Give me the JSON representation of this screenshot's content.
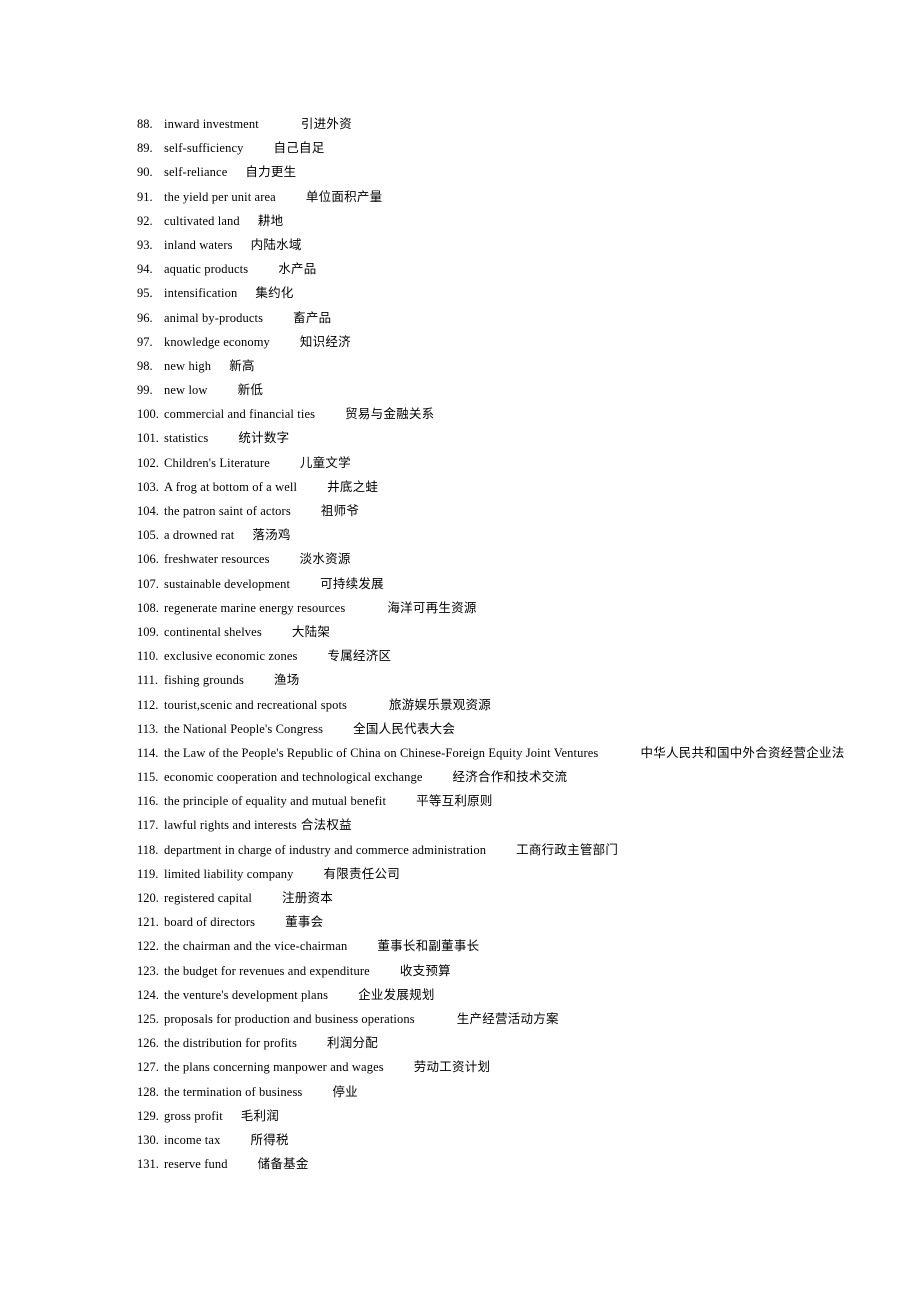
{
  "document": {
    "type": "bilingual-glossary",
    "language_pair": "English-Chinese",
    "first_item_number": 88,
    "last_item_number": 131
  },
  "entries": [
    {
      "num": "88.",
      "en": "inward investment",
      "zh": "引进外资",
      "gap": "gap-l"
    },
    {
      "num": "89.",
      "en": "self-sufficiency",
      "zh": "自己自足",
      "gap": "gap-m"
    },
    {
      "num": "90.",
      "en": "self-reliance",
      "zh": "自力更生",
      "gap": "gap-s"
    },
    {
      "num": "91.",
      "en": "the yield per unit area",
      "zh": "单位面积产量",
      "gap": "gap-m"
    },
    {
      "num": "92.",
      "en": "cultivated land",
      "zh": "耕地",
      "gap": "gap-s"
    },
    {
      "num": "93.",
      "en": "inland waters",
      "zh": "内陆水域",
      "gap": "gap-s"
    },
    {
      "num": "94.",
      "en": "aquatic products",
      "zh": "水产品",
      "gap": "gap-m"
    },
    {
      "num": "95.",
      "en": "intensification",
      "zh": "集约化",
      "gap": "gap-s"
    },
    {
      "num": "96.",
      "en": "animal by-products",
      "zh": "畜产品",
      "gap": "gap-m"
    },
    {
      "num": "97.",
      "en": "knowledge economy",
      "zh": "知识经济",
      "gap": "gap-m"
    },
    {
      "num": "98.",
      "en": "new high",
      "zh": "新高",
      "gap": "gap-s"
    },
    {
      "num": "99.",
      "en": "new low",
      "zh": "新低",
      "gap": "gap-m"
    },
    {
      "num": "100.",
      "en": "commercial and financial ties",
      "zh": "贸易与金融关系",
      "gap": "gap-m"
    },
    {
      "num": "101.",
      "en": "statistics",
      "zh": "统计数字",
      "gap": "gap-m"
    },
    {
      "num": "102.",
      "en": "Children's Literature",
      "zh": "儿童文学",
      "gap": "gap-m"
    },
    {
      "num": "103.",
      "en": "A frog at bottom of a well",
      "zh": "井底之蛙",
      "gap": "gap-m"
    },
    {
      "num": "104.",
      "en": "the patron saint of actors",
      "zh": "祖师爷",
      "gap": "gap-m"
    },
    {
      "num": "105.",
      "en": "a drowned rat",
      "zh": "落汤鸡",
      "gap": "gap-s"
    },
    {
      "num": "106.",
      "en": "freshwater resources",
      "zh": "淡水资源",
      "gap": "gap-m"
    },
    {
      "num": "107.",
      "en": "sustainable development",
      "zh": "可持续发展",
      "gap": "gap-m"
    },
    {
      "num": "108.",
      "en": "regenerate marine energy resources",
      "zh": "海洋可再生资源",
      "gap": "gap-l"
    },
    {
      "num": "109.",
      "en": "continental shelves",
      "zh": "大陆架",
      "gap": "gap-m"
    },
    {
      "num": "110.",
      "en": "exclusive economic zones",
      "zh": "专属经济区",
      "gap": "gap-m"
    },
    {
      "num": "111.",
      "en": "fishing grounds",
      "zh": "渔场",
      "gap": "gap-m"
    },
    {
      "num": "112.",
      "en": "tourist,scenic and recreational spots",
      "zh": "旅游娱乐景观资源",
      "gap": "gap-l"
    },
    {
      "num": "113.",
      "en": "the National People's Congress",
      "zh": "全国人民代表大会",
      "gap": "gap-m"
    },
    {
      "num": "114.",
      "en": "the Law of the People's Republic of China on Chinese-Foreign Equity Joint Ventures",
      "zh": "中华人民共和国中外合资经营企业法",
      "gap": "gap-l"
    },
    {
      "num": "115.",
      "en": "economic cooperation and technological exchange",
      "zh": "经济合作和技术交流",
      "gap": "gap-m"
    },
    {
      "num": "116.",
      "en": "the principle of equality and mutual benefit",
      "zh": "平等互利原则",
      "gap": "gap-m"
    },
    {
      "num": "117.",
      "en": "lawful rights and interests",
      "zh": "合法权益",
      "gap": "gap-xs"
    },
    {
      "num": "118.",
      "en": "department in charge of industry and commerce administration",
      "zh": "工商行政主管部门",
      "gap": "gap-m"
    },
    {
      "num": "119.",
      "en": "limited liability company",
      "zh": "有限责任公司",
      "gap": "gap-m"
    },
    {
      "num": "120.",
      "en": "registered capital",
      "zh": "注册资本",
      "gap": "gap-m"
    },
    {
      "num": "121.",
      "en": "board of directors",
      "zh": "董事会",
      "gap": "gap-m"
    },
    {
      "num": "122.",
      "en": "the chairman and the vice-chairman",
      "zh": "董事长和副董事长",
      "gap": "gap-m"
    },
    {
      "num": "123.",
      "en": "the budget for revenues and expenditure",
      "zh": "收支预算",
      "gap": "gap-m"
    },
    {
      "num": "124.",
      "en": "the venture's development plans",
      "zh": "企业发展规划",
      "gap": "gap-m"
    },
    {
      "num": "125.",
      "en": "proposals for production and business operations",
      "zh": "生产经营活动方案",
      "gap": "gap-l"
    },
    {
      "num": "126.",
      "en": "the distribution for profits",
      "zh": "利润分配",
      "gap": "gap-m"
    },
    {
      "num": "127.",
      "en": "the plans concerning manpower and wages",
      "zh": "劳动工资计划",
      "gap": "gap-m"
    },
    {
      "num": "128.",
      "en": "the termination of business",
      "zh": "停业",
      "gap": "gap-m"
    },
    {
      "num": "129.",
      "en": "gross profit",
      "zh": "毛利润",
      "gap": "gap-s"
    },
    {
      "num": "130.",
      "en": "income tax",
      "zh": "所得税",
      "gap": "gap-m"
    },
    {
      "num": "131.",
      "en": "reserve fund",
      "zh": "储备基金",
      "gap": "gap-m"
    }
  ]
}
